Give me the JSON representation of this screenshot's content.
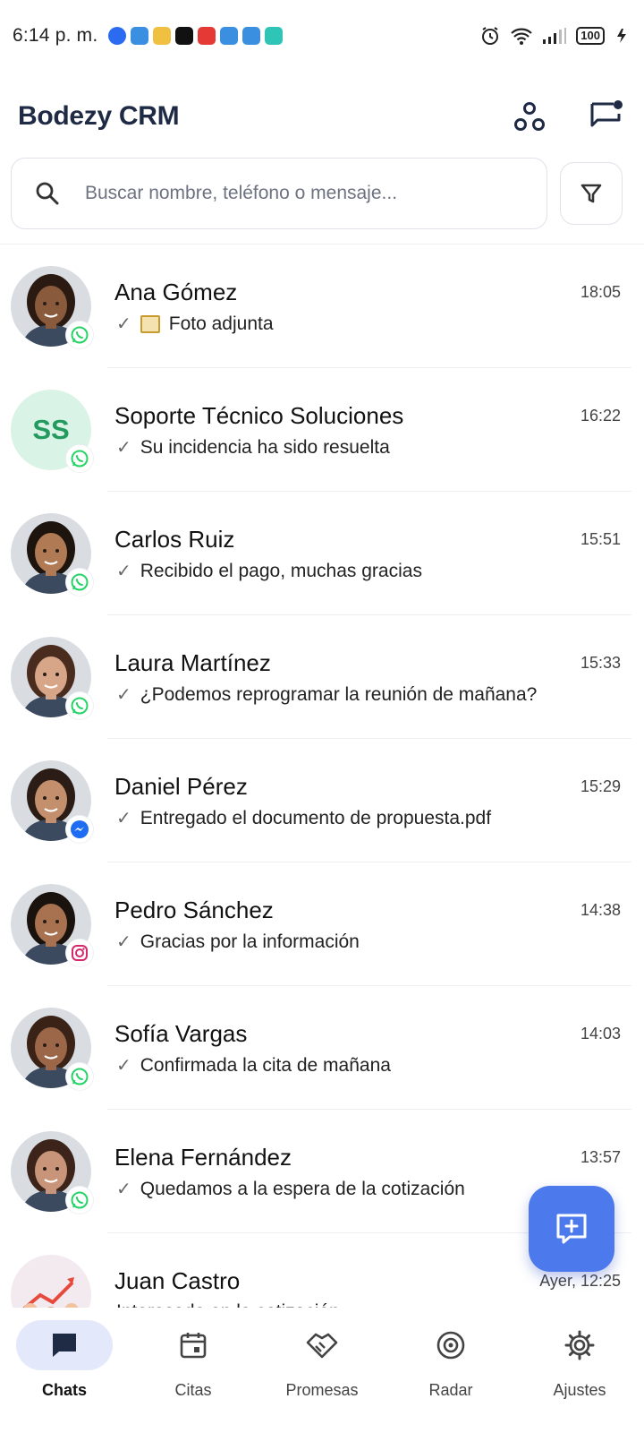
{
  "status_bar": {
    "time": "6:14 p. m.",
    "battery": "100",
    "notification_icons": [
      {
        "name": "messenger-notif-icon",
        "color": "#2a6bf2"
      },
      {
        "name": "app-notif-icon",
        "color": "#3b8fe0"
      },
      {
        "name": "app-notif-icon",
        "color": "#f0c040"
      },
      {
        "name": "app-notif-icon",
        "color": "#111111"
      },
      {
        "name": "app-notif-icon",
        "color": "#e53935"
      },
      {
        "name": "app-notif-icon",
        "color": "#3b8fe0"
      },
      {
        "name": "app-notif-icon",
        "color": "#3b8fe0"
      },
      {
        "name": "app-notif-icon",
        "color": "#2ec4b6"
      }
    ]
  },
  "header": {
    "title": "Bodezy CRM",
    "actions": [
      "connections-icon",
      "new-message-icon"
    ]
  },
  "search": {
    "placeholder": "Buscar nombre, teléfono o mensaje..."
  },
  "chats": [
    {
      "name": "Ana Gómez",
      "time": "18:05",
      "preview": "Foto adjunta",
      "has_photo": true,
      "channel": "whatsapp",
      "avatar": "photo",
      "skin": "#8a5a3c",
      "hair": "#2a1a12"
    },
    {
      "name": "Soporte Técnico Soluciones",
      "time": "16:22",
      "preview": "Su incidencia ha sido resuelta",
      "channel": "whatsapp",
      "avatar": "initials",
      "initials": "SS"
    },
    {
      "name": "Carlos Ruiz",
      "time": "15:51",
      "preview": "Recibido el pago, muchas gracias",
      "channel": "whatsapp",
      "avatar": "photo",
      "skin": "#b07a55",
      "hair": "#1d140e"
    },
    {
      "name": "Laura Martínez",
      "time": "15:33",
      "preview": "¿Podemos reprogramar la reunión de mañana?",
      "channel": "whatsapp",
      "avatar": "photo",
      "skin": "#d7a688",
      "hair": "#4a2c1e"
    },
    {
      "name": "Daniel Pérez",
      "time": "15:29",
      "preview": "Entregado el documento de propuesta.pdf",
      "channel": "messenger",
      "avatar": "photo",
      "skin": "#c48f6c",
      "hair": "#2b1d15"
    },
    {
      "name": "Pedro Sánchez",
      "time": "14:38",
      "preview": "Gracias por la información",
      "channel": "instagram",
      "avatar": "photo",
      "skin": "#a87150",
      "hair": "#1a120c"
    },
    {
      "name": "Sofía Vargas",
      "time": "14:03",
      "preview": "Confirmada la cita de mañana",
      "channel": "whatsapp",
      "avatar": "photo",
      "skin": "#9c6748",
      "hair": "#3a2217"
    },
    {
      "name": "Elena Fernández",
      "time": "13:57",
      "preview": "Quedamos a la espera de la cotización",
      "channel": "whatsapp",
      "avatar": "photo",
      "skin": "#c8957a",
      "hair": "#3d241a"
    },
    {
      "name": "Juan Castro",
      "time": "Ayer, 12:25",
      "preview": "Interesado en la cotización",
      "channel": "none",
      "avatar": "illustration"
    }
  ],
  "nav": [
    {
      "label": "Chats",
      "icon": "chat-bubble-icon",
      "active": true
    },
    {
      "label": "Citas",
      "icon": "calendar-icon",
      "active": false
    },
    {
      "label": "Promesas",
      "icon": "handshake-icon",
      "active": false
    },
    {
      "label": "Radar",
      "icon": "radar-icon",
      "active": false
    },
    {
      "label": "Ajustes",
      "icon": "gear-icon",
      "active": false
    }
  ],
  "colors": {
    "accent": "#4c79ec",
    "title": "#1f2a44",
    "whatsapp": "#25d366",
    "messenger": "#1e6cf2",
    "instagram": "#d6286c",
    "initials_bg": "#d9f3e6",
    "initials_fg": "#239a5e"
  }
}
